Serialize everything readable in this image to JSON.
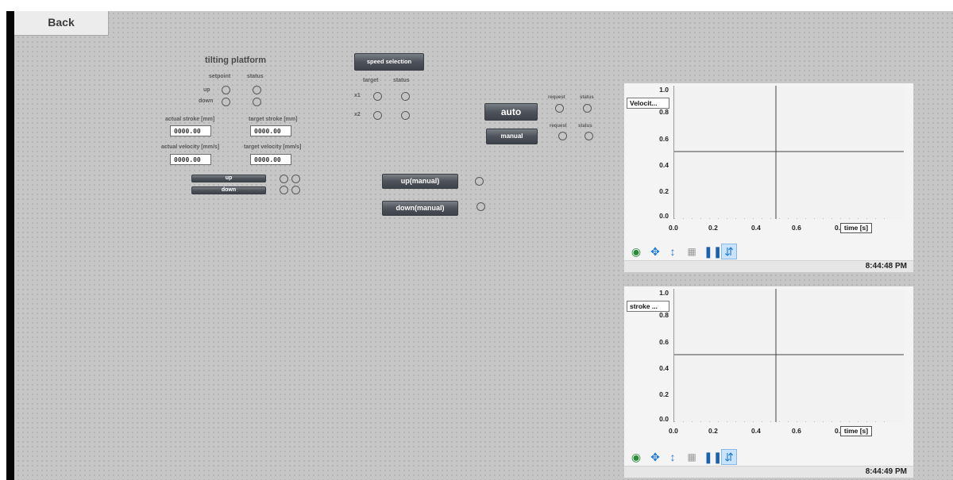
{
  "nav": {
    "back_label": "Back"
  },
  "tilting": {
    "title": "tilting platform",
    "col_setpoint": "setpoint",
    "col_status": "status",
    "row_up": "up",
    "row_down": "down",
    "actual_stroke_label": "actual stroke [mm]",
    "target_stroke_label": "target stroke [mm]",
    "actual_stroke_value": "0000.00",
    "target_stroke_value": "0000.00",
    "actual_velocity_label": "actual velocity [mm/s]",
    "target_velocity_label": "target velocity [mm/s]",
    "actual_velocity_value": "0000.00",
    "target_velocity_value": "0000.00",
    "up_button": "up",
    "down_button": "down"
  },
  "speed": {
    "button": "speed selection",
    "col_target": "target",
    "col_status": "status",
    "row1": "x1",
    "row2": "x2"
  },
  "mode": {
    "auto_button": "auto",
    "manual_button": "manual",
    "col_request": "request",
    "col_status": "status"
  },
  "manual": {
    "up_button": "up(manual)",
    "down_button": "down(manual)"
  },
  "trends": [
    {
      "series_label": "Velocit...",
      "x_label": "time [s]",
      "y_ticks": [
        "1.0",
        "0.8",
        "0.6",
        "0.4",
        "0.2",
        "0.0"
      ],
      "x_ticks": [
        "0.0",
        "0.2",
        "0.4",
        "0.6",
        "0."
      ],
      "time": "8:44:48 PM"
    },
    {
      "series_label": "stroke ...",
      "x_label": "time [s]",
      "y_ticks": [
        "1.0",
        "0.8",
        "0.6",
        "0.4",
        "0.2",
        "0.0"
      ],
      "x_ticks": [
        "0.0",
        "0.2",
        "0.4",
        "0.6",
        "0."
      ],
      "time": "8:44:49 PM"
    }
  ],
  "icons": [
    "zoom-icon",
    "pan-icon",
    "scale-icon",
    "one-to-one-icon",
    "pause-icon",
    "ruler-icon"
  ],
  "colors": {
    "background": "#c6c6c6",
    "button_dark": "#4e535b",
    "accent_blue": "#1e7ad8"
  }
}
